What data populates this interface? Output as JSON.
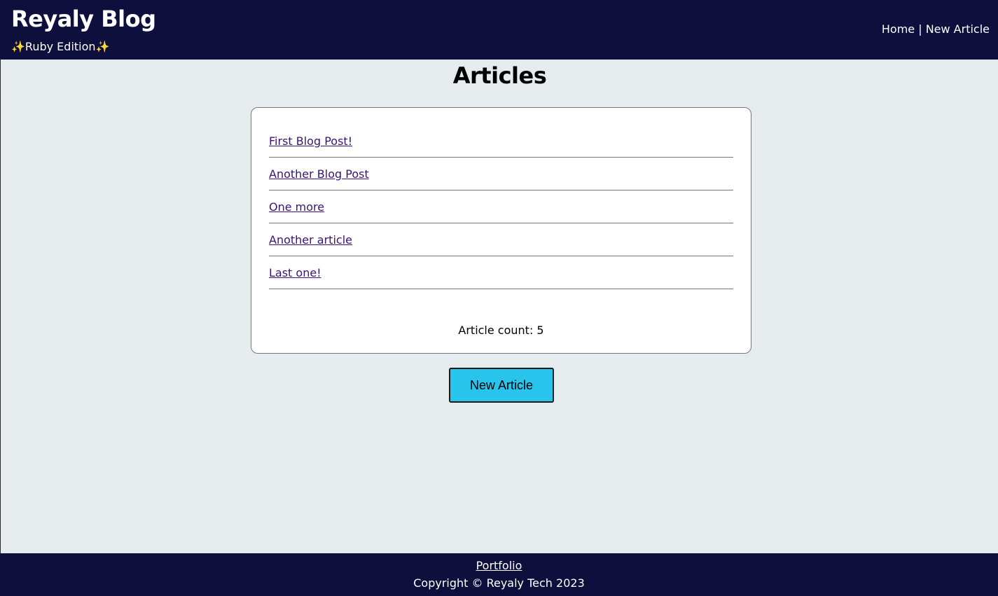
{
  "header": {
    "title": "Reyaly Blog",
    "subtitle_prefix": "✨",
    "subtitle": "Ruby Edition",
    "subtitle_suffix": "✨",
    "nav": {
      "home": "Home",
      "separator": " | ",
      "new_article": "New Article"
    }
  },
  "main": {
    "heading": "Articles",
    "articles": [
      {
        "title": "First Blog Post!"
      },
      {
        "title": "Another Blog Post"
      },
      {
        "title": "One more"
      },
      {
        "title": "Another article"
      },
      {
        "title": "Last one!"
      }
    ],
    "article_count": "Article count: 5",
    "new_article_button": "New Article"
  },
  "footer": {
    "portfolio_link": "Portfolio",
    "copyright": "Copyright © Reyaly Tech 2023"
  },
  "colors": {
    "header_bg": "#0e0f3d",
    "page_bg": "#e6eced",
    "link": "#3b1372",
    "button_bg": "#29c4ec"
  }
}
